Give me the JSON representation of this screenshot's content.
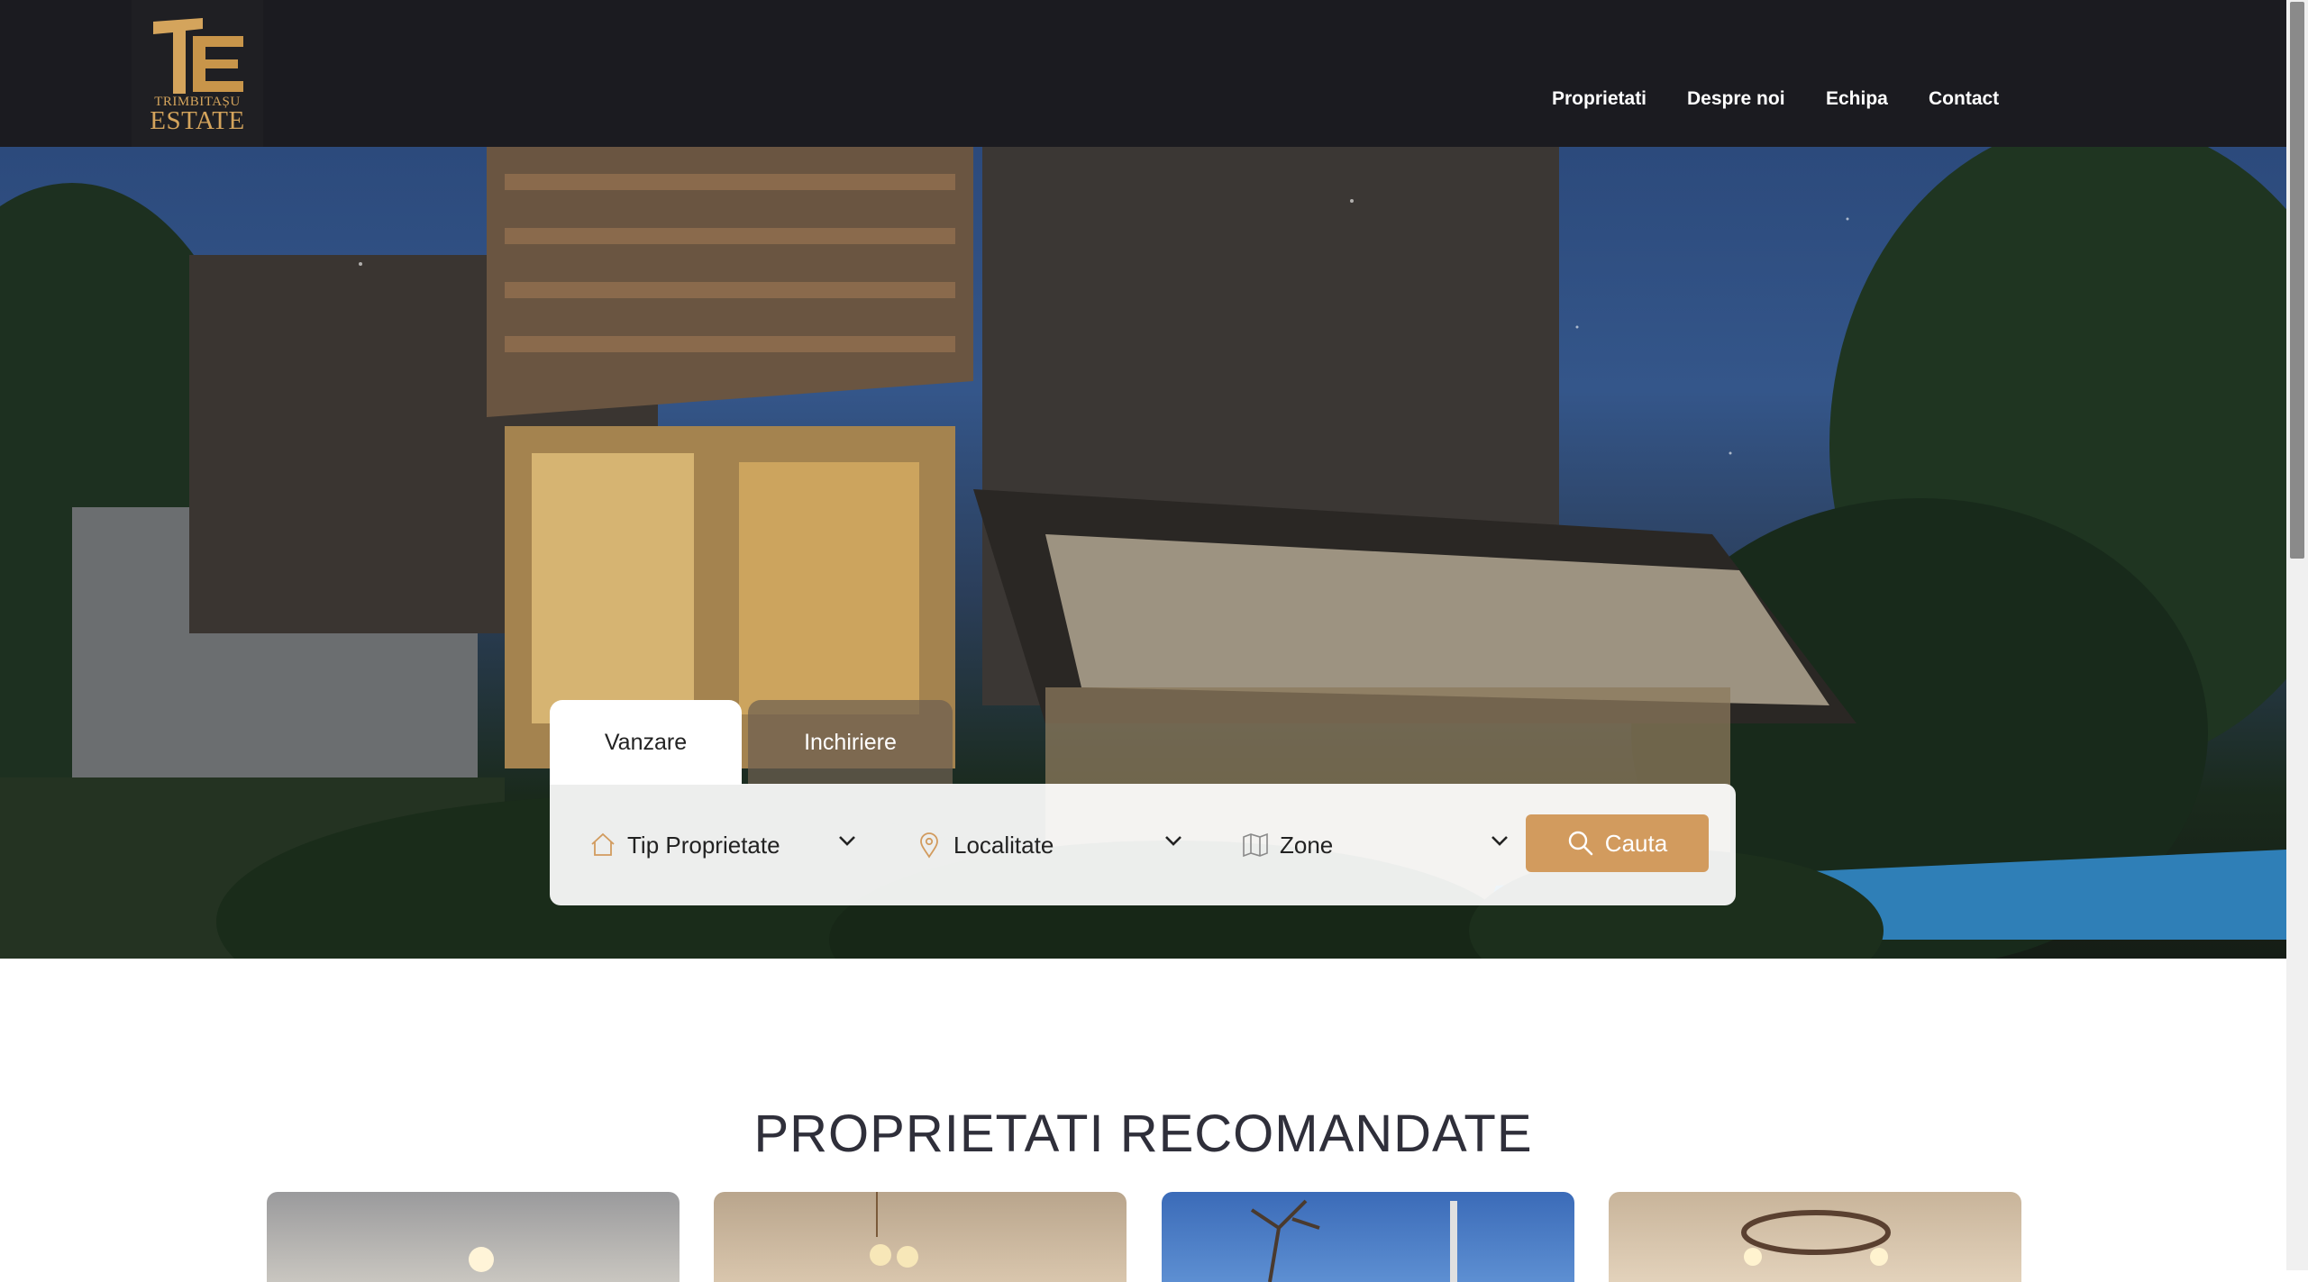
{
  "brand": {
    "line1": "TRIMBITAȘU",
    "line2": "ESTATE",
    "color": "#d4a45c"
  },
  "nav": {
    "items": [
      "Proprietati",
      "Despre noi",
      "Echipa",
      "Contact"
    ]
  },
  "search": {
    "tabs": [
      "Vanzare",
      "Inchiriere"
    ],
    "active_tab": "Vanzare",
    "fields": [
      {
        "label": "Tip Proprietate",
        "icon": "home-icon"
      },
      {
        "label": "Localitate",
        "icon": "map-pin-icon"
      },
      {
        "label": "Zone",
        "icon": "map-icon"
      }
    ],
    "button_label": "Cauta",
    "accent": "#d29b5e"
  },
  "section": {
    "title": "PROPRIETATI RECOMANDATE"
  },
  "colors": {
    "header_bg": "#1b1b20",
    "title_text": "#2f2f3a"
  }
}
